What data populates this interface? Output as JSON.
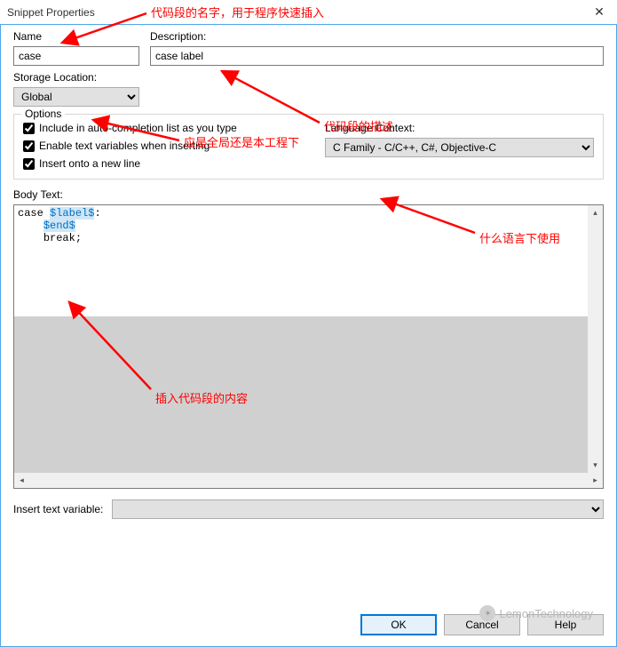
{
  "window": {
    "title": "Snippet Properties",
    "close": "✕"
  },
  "fields": {
    "name_label": "Name",
    "name_value": "case",
    "desc_label": "Description:",
    "desc_value": "case label",
    "storage_label": "Storage Location:",
    "storage_value": "Global"
  },
  "options": {
    "legend": "Options",
    "cb_auto": "Include in auto-completion list as you type",
    "cb_vars": "Enable text variables when inserting",
    "cb_newline": "Insert onto a new line",
    "lang_label": "Language Context:",
    "lang_value": "C Family - C/C++, C#, Objective-C"
  },
  "body": {
    "label": "Body Text:",
    "line1_a": "case ",
    "line1_b": "$label$",
    "line1_c": ":",
    "line2": "$end$",
    "line3": "break;"
  },
  "insert": {
    "label": "Insert text variable:",
    "value": ""
  },
  "buttons": {
    "ok": "OK",
    "cancel": "Cancel",
    "help": "Help"
  },
  "annotations": {
    "a1": "代码段的名字，用于程序快速插入",
    "a2": "代码段的描述",
    "a3": "应是全局还是本工程下",
    "a4": "什么语言下使用",
    "a5": "插入代码段的内容"
  },
  "scroll": {
    "up": "▴",
    "down": "▾",
    "left": "◂",
    "right": "▸"
  },
  "watermark": "LemonTechnology"
}
